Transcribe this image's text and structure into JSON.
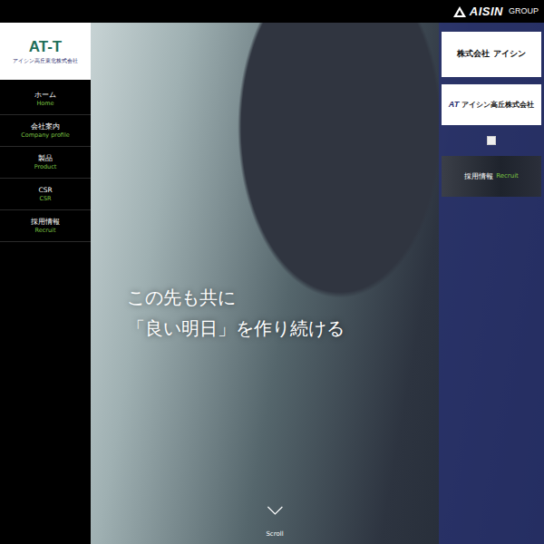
{
  "header": {
    "group_logo": "AISIN",
    "group_suffix": "GROUP"
  },
  "sidebar": {
    "logo_mark": "AT-T",
    "company": "アイシン高丘東北株式会社",
    "items": [
      {
        "label": "ホーム",
        "sub": "Home",
        "selected": false
      },
      {
        "label": "会社案内",
        "sub": "Company profile",
        "selected": false
      },
      {
        "label": "製品",
        "sub": "Product",
        "selected": false
      },
      {
        "label": "CSR",
        "sub": "CSR",
        "selected": false
      },
      {
        "label": "採用情報",
        "sub": "Recruit",
        "selected": false
      }
    ]
  },
  "hero": {
    "lines": [
      "この先も共に",
      "「良い明日」を作り続ける"
    ],
    "scroll": "Scroll"
  },
  "banners": [
    {
      "kind": "text",
      "label": "株式会社 アイシン"
    },
    {
      "kind": "logo",
      "mark": "AT",
      "label": "アイシン高丘株式会社"
    },
    {
      "kind": "broken",
      "label": ""
    },
    {
      "kind": "photo",
      "label": "採用情報",
      "sub": "Recruit"
    }
  ]
}
